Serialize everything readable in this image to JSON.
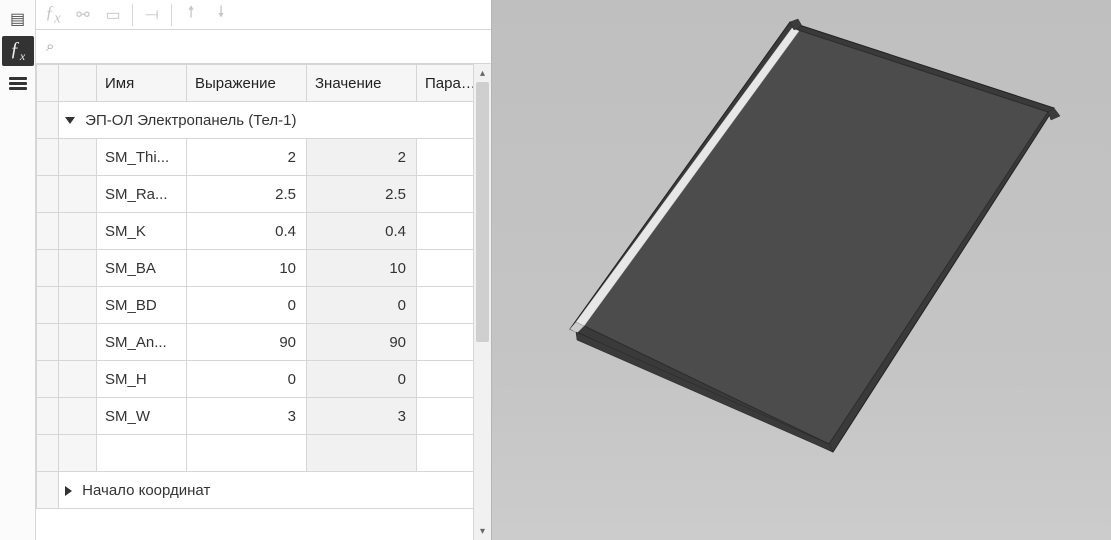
{
  "rail": {
    "items": [
      {
        "id": "box-icon",
        "glyph": "▤"
      },
      {
        "id": "fx-icon",
        "glyph": "ƒx",
        "selected": true
      },
      {
        "id": "menu-icon",
        "glyph": "burger"
      }
    ]
  },
  "toolbar": {
    "items": [
      {
        "id": "fx-btn",
        "glyph": "ƒx"
      },
      {
        "id": "link-btn",
        "glyph": "⚯"
      },
      {
        "id": "panel-btn",
        "glyph": "▭"
      },
      {
        "id": "sep"
      },
      {
        "id": "fg-btn",
        "glyph": "⟞"
      },
      {
        "id": "sep"
      },
      {
        "id": "up-btn",
        "glyph": "🠕"
      },
      {
        "id": "down-btn",
        "glyph": "🠗"
      }
    ]
  },
  "search": {
    "placeholder": ""
  },
  "columns": {
    "name": "Имя",
    "expression": "Выражение",
    "value": "Значение",
    "parameter": "Парамет"
  },
  "groups": [
    {
      "title": "ЭП-ОЛ Электропанель (Тел-1)",
      "expanded": true,
      "rows": [
        {
          "name": "SM_Thi...",
          "expression": "2",
          "value": "2"
        },
        {
          "name": "SM_Ra...",
          "expression": "2.5",
          "value": "2.5"
        },
        {
          "name": "SM_K",
          "expression": "0.4",
          "value": "0.4"
        },
        {
          "name": "SM_BA",
          "expression": "10",
          "value": "10"
        },
        {
          "name": "SM_BD",
          "expression": "0",
          "value": "0"
        },
        {
          "name": "SM_An...",
          "expression": "90",
          "value": "90"
        },
        {
          "name": "SM_H",
          "expression": "0",
          "value": "0"
        },
        {
          "name": "SM_W",
          "expression": "3",
          "value": "3"
        }
      ]
    },
    {
      "title": "Начало координат",
      "expanded": false,
      "rows": []
    }
  ]
}
